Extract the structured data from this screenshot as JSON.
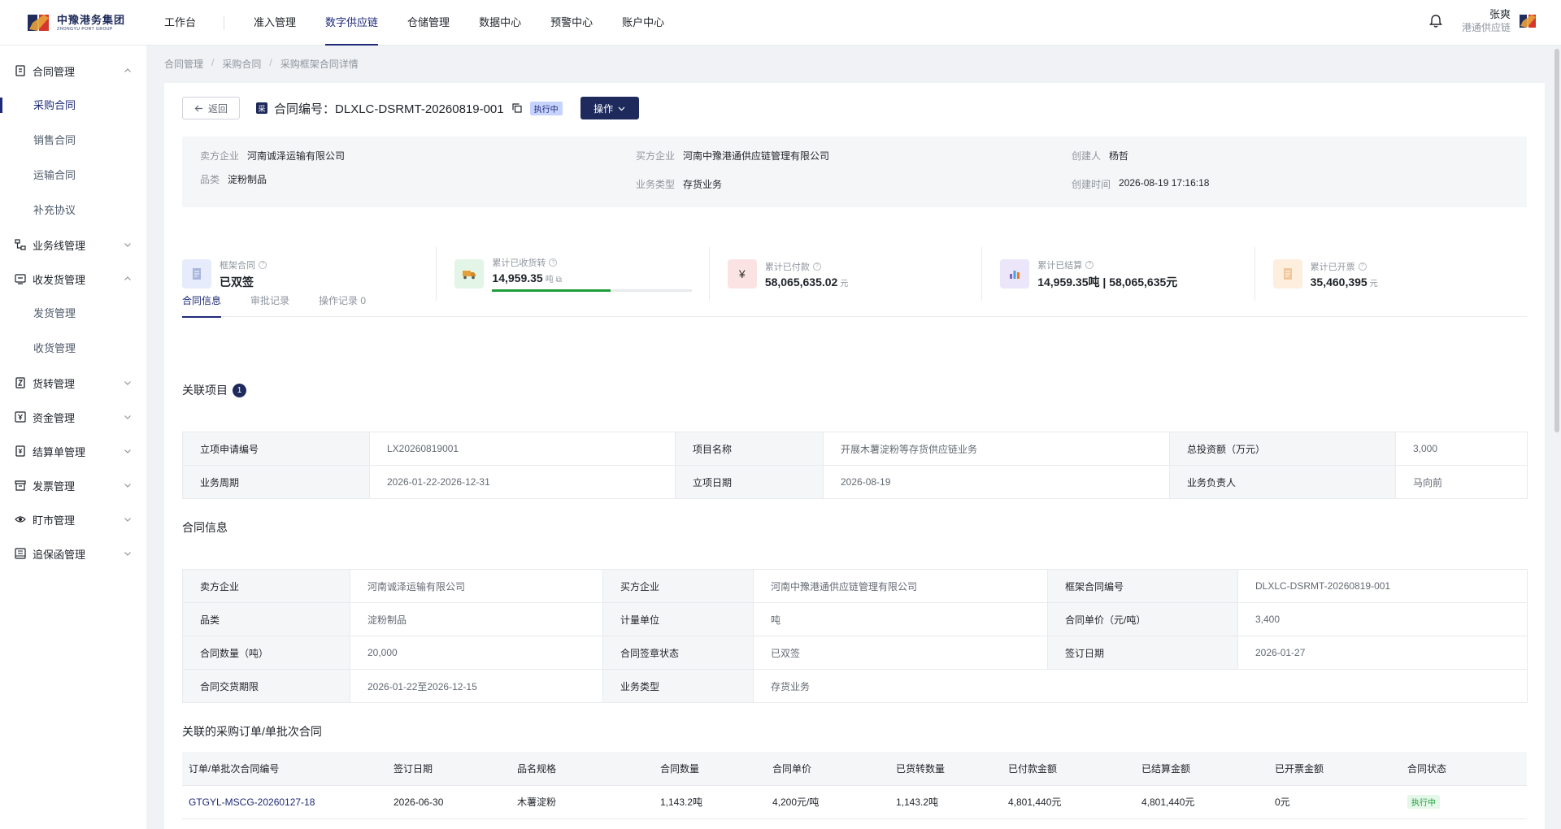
{
  "header": {
    "logo_cn": "中豫港务集团",
    "logo_en": "ZHONGYU PORT GROUP",
    "nav": [
      "工作台",
      "准入管理",
      "数字供应链",
      "仓储管理",
      "数据中心",
      "预警中心",
      "账户中心"
    ],
    "active_nav": "数字供应链",
    "user_name": "张爽",
    "user_org": "港通供应链"
  },
  "sidebar": {
    "items": [
      {
        "label": "合同管理",
        "icon": "contract-icon",
        "expanded": true
      },
      {
        "label": "采购合同",
        "sub": true,
        "active": true
      },
      {
        "label": "销售合同",
        "sub": true
      },
      {
        "label": "运输合同",
        "sub": true
      },
      {
        "label": "补充协议",
        "sub": true
      },
      {
        "label": "业务线管理",
        "icon": "flow-icon",
        "expanded": false
      },
      {
        "label": "收发货管理",
        "icon": "delivery-icon",
        "expanded": true
      },
      {
        "label": "发货管理",
        "sub": true
      },
      {
        "label": "收货管理",
        "sub": true
      },
      {
        "label": "货转管理",
        "icon": "transfer-icon",
        "expanded": false
      },
      {
        "label": "资金管理",
        "icon": "fund-icon",
        "expanded": false
      },
      {
        "label": "结算单管理",
        "icon": "settle-icon",
        "expanded": false
      },
      {
        "label": "发票管理",
        "icon": "invoice-icon",
        "expanded": false
      },
      {
        "label": "盯市管理",
        "icon": "eye-icon",
        "expanded": false
      },
      {
        "label": "追保函管理",
        "icon": "letter-icon",
        "expanded": false
      }
    ]
  },
  "breadcrumb": [
    "合同管理",
    "采购合同",
    "采购框架合同详情"
  ],
  "head": {
    "back_label": "返回",
    "type_glyph": "采",
    "contract_title": "合同编号：DLXLC-DSRMT-20260819-001",
    "status": "执行中",
    "op_label": "操作"
  },
  "info": {
    "seller_k": "卖方企业",
    "seller_v": "河南诚泽运输有限公司",
    "buyer_k": "买方企业",
    "buyer_v": "河南中豫港通供应链管理有限公司",
    "creator_k": "创建人",
    "creator_v": "杨哲",
    "category_k": "品类",
    "category_v": "淀粉制品",
    "biz_k": "业务类型",
    "biz_v": "存货业务",
    "ctime_k": "创建时间",
    "ctime_v": "2026-08-19 17:16:18"
  },
  "stats": [
    {
      "label": "框架合同",
      "value": "已双签",
      "unit": "",
      "icon": "document-icon",
      "bg": "#e6ecfb",
      "fg": "#7d8fc4"
    },
    {
      "label": "累计已收货转",
      "value": "14,959.35",
      "unit": "吨",
      "icon": "truck-icon",
      "bg": "#e3f5e6",
      "fg": "#e4a03a",
      "progress": 0.59
    },
    {
      "label": "累计已付款",
      "value": "58,065,635.02",
      "unit": "元",
      "icon": "yen-icon",
      "bg": "#fbe3e3",
      "fg": "#c0392b"
    },
    {
      "label": "累计已结算",
      "value": "14,959.35吨 | 58,065,635元",
      "unit": "",
      "icon": "bar-chart-icon",
      "bg": "#ece6fb",
      "fg": "#7d67c4"
    },
    {
      "label": "累计已开票",
      "value": "35,460,395",
      "unit": "元",
      "icon": "receipt-icon",
      "bg": "#fdeedd",
      "fg": "#d9a06a"
    }
  ],
  "tabs": [
    "合同信息",
    "审批记录",
    "操作记录 0"
  ],
  "project": {
    "title": "关联项目",
    "count": "1",
    "rows": [
      [
        "立项申请编号",
        "LX20260819001",
        "项目名称",
        "开展木薯淀粉等存货供应链业务",
        "总投资额（万元）",
        "3,000"
      ],
      [
        "业务周期",
        "2026-01-22-2026-12-31",
        "立项日期",
        "2026-08-19",
        "业务负责人",
        "马向前"
      ]
    ]
  },
  "contract": {
    "title": "合同信息",
    "rows": [
      [
        "卖方企业",
        "河南诚泽运输有限公司",
        "买方企业",
        "河南中豫港通供应链管理有限公司",
        "框架合同编号",
        "DLXLC-DSRMT-20260819-001"
      ],
      [
        "品类",
        "淀粉制品",
        "计量单位",
        "吨",
        "合同单价（元/吨）",
        "3,400"
      ],
      [
        "合同数量（吨）",
        "20,000",
        "合同签章状态",
        "已双签",
        "签订日期",
        "2026-01-27"
      ],
      [
        "合同交货期限",
        "2026-01-22至2026-12-15",
        "业务类型",
        "存货业务",
        "",
        ""
      ]
    ]
  },
  "orders": {
    "title": "关联的采购订单/单批次合同",
    "headers": [
      "订单/单批次合同编号",
      "签订日期",
      "品名规格",
      "合同数量",
      "合同单价",
      "已货转数量",
      "已付款金额",
      "已结算金额",
      "已开票金额",
      "合同状态"
    ],
    "rows": [
      [
        "GTGYL-MSCG-20260127-18",
        "2026-06-30",
        "木薯淀粉",
        "1,143.2吨",
        "4,200元/吨",
        "1,143.2吨",
        "4,801,440元",
        "4,801,440元",
        "0元",
        "执行中"
      ]
    ]
  },
  "colors": {
    "brand": "#1e2a5c",
    "accent": "#1e2a78",
    "success": "#1f9d3a"
  }
}
